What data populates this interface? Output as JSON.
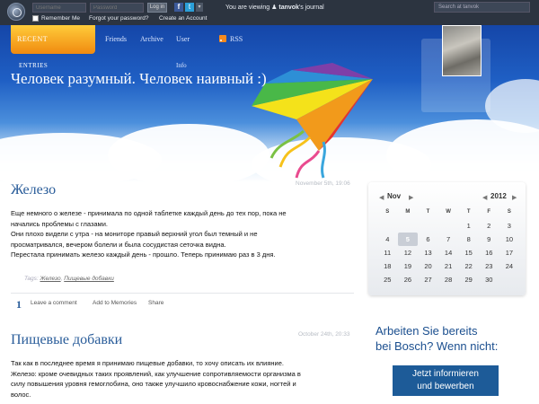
{
  "topbar": {
    "username_placeholder": "Username",
    "password_placeholder": "Password",
    "login_label": "Log in",
    "remember_label": "Remember Me",
    "forgot_label": "Forgot your password?",
    "create_label": "Create an Account",
    "viewing_prefix": "You are viewing",
    "viewing_user": "tanvok",
    "viewing_suffix": "'s journal",
    "search_placeholder": "Search at tanvok"
  },
  "nav": {
    "recent": "RECENT",
    "entries": "ENTRIES",
    "friends": "Friends",
    "archive": "Archive",
    "user": "User",
    "info": "Info",
    "rss": "RSS"
  },
  "site_title": "Человек разумный. Человек наивный :)",
  "posts": [
    {
      "title": "Железо",
      "date": "November 5th, 19:06",
      "body": [
        "Еще немного о железе - принимала по одной таблетке каждый день до тех пор, пока не",
        "начались проблемы с глазами.",
        "Они плохо видели с утра - на мониторе правый верхний угол был темный и не",
        "просматривался, вечером болели и была сосудистая сеточка видна.",
        "Перестала принимать железо каждый день - прошло. Теперь принимаю раз в 3 дня."
      ],
      "tags_label": "Tags:",
      "tags": [
        "Железо",
        "Пищевые добавки"
      ],
      "comment_count": "1",
      "actions": [
        "Leave a comment",
        "Add to Memories",
        "Share"
      ]
    },
    {
      "title": "Пищевые добавки",
      "date": "October 24th, 20:33",
      "body": [
        "Так как в последнее время я принимаю пищевые добавки, то хочу описать их влияние.",
        "Железо: кроме очевидных таких проявлений, как улучшение сопротивляемости организма в",
        "силу повышения уровня гемоглобина, оно также улучшило кровоснабжение кожи, ногтей и",
        "волос."
      ]
    }
  ],
  "calendar": {
    "month": "Nov",
    "year": "2012",
    "weekdays": [
      "S",
      "M",
      "T",
      "W",
      "T",
      "F",
      "S"
    ],
    "weeks": [
      [
        "",
        "",
        "",
        "",
        "1",
        "2",
        "3"
      ],
      [
        "4",
        "5",
        "6",
        "7",
        "8",
        "9",
        "10"
      ],
      [
        "11",
        "12",
        "13",
        "14",
        "15",
        "16",
        "17"
      ],
      [
        "18",
        "19",
        "20",
        "21",
        "22",
        "23",
        "24"
      ],
      [
        "25",
        "26",
        "27",
        "28",
        "29",
        "30",
        ""
      ]
    ],
    "today": "5"
  },
  "ad": {
    "line1": "Arbeiten Sie bereits",
    "line2": "bei Bosch? Wenn nicht:",
    "button_line1": "Jetzt informieren",
    "button_line2": "und bewerben"
  }
}
